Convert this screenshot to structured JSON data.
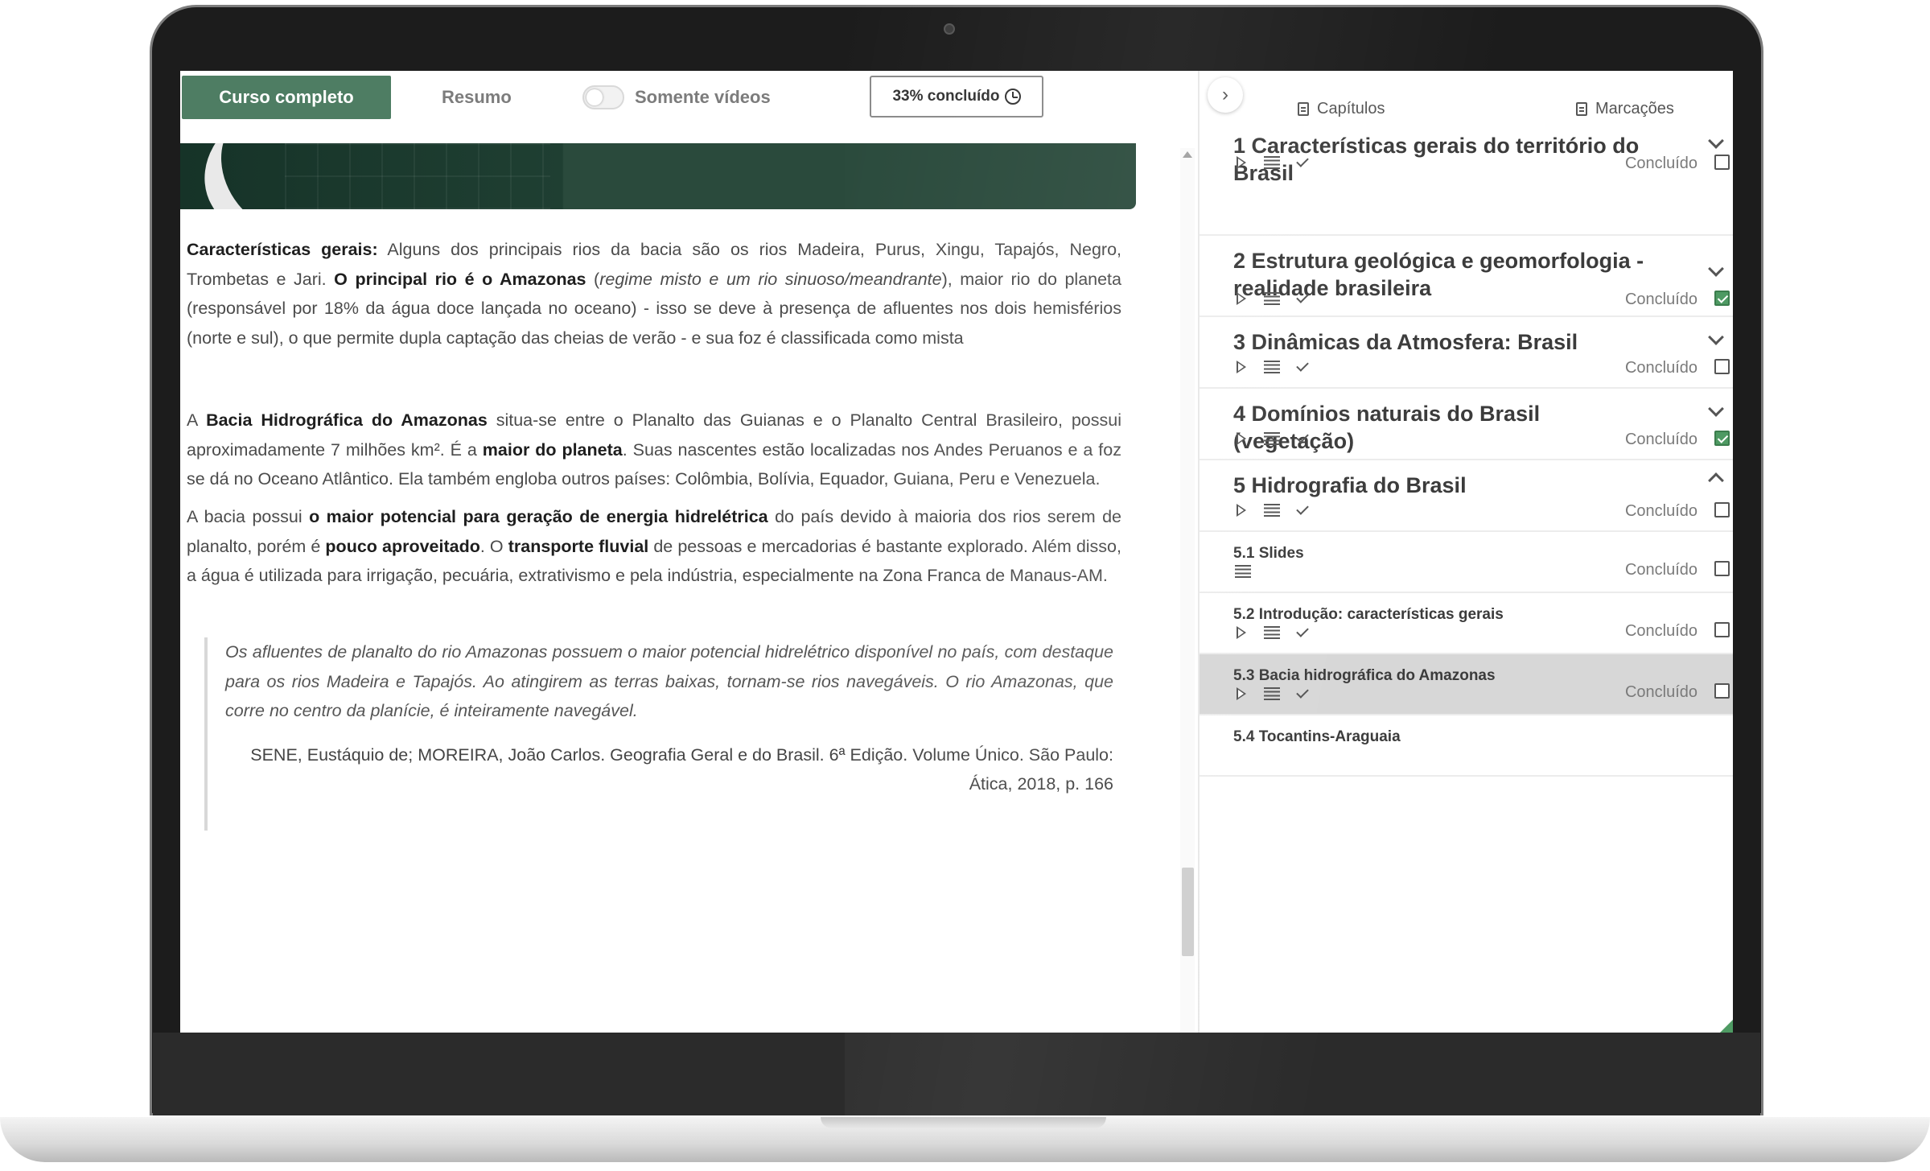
{
  "topbar": {
    "full_course_label": "Curso completo",
    "summary_label": "Resumo",
    "videos_only_label": "Somente vídeos",
    "progress_label": "33% concluído"
  },
  "article": {
    "p1": [
      {
        "t": "Características gerais:",
        "b": true
      },
      {
        "t": " Alguns dos principais rios da bacia são os rios Madeira, Purus, Xingu, Tapajós, Negro, Trombetas e Jari. ",
        "b": false
      },
      {
        "t": "O principal rio é o Amazonas",
        "b": true
      },
      {
        "t": " (",
        "b": false
      },
      {
        "t": "regime misto e um rio sinuoso/meandrante",
        "b": false,
        "i": true
      },
      {
        "t": "), maior rio do planeta (responsável por 18% da água doce lançada no oceano) - isso se deve à presença de afluentes nos dois hemisférios (norte e sul), o que permite dupla captação das cheias de verão -  e sua foz é classificada como mista",
        "b": false
      }
    ],
    "p2": [
      {
        "t": "A ",
        "b": false
      },
      {
        "t": "Bacia Hidrográfica do Amazonas",
        "b": true
      },
      {
        "t": " situa-se entre o Planalto das Guianas e o Planalto Central Brasileiro, possui aproximadamente 7 milhões km². É a ",
        "b": false
      },
      {
        "t": "maior do planeta",
        "b": true
      },
      {
        "t": ". Suas nascentes estão localizadas nos Andes Peruanos e a foz se dá no Oceano Atlântico. Ela também engloba outros países: Colômbia, Bolívia, Equador, Guiana, Peru e Venezuela.",
        "b": false
      }
    ],
    "p3": [
      {
        "t": "A bacia possui ",
        "b": false
      },
      {
        "t": "o maior potencial para geração de energia hidrelétrica",
        "b": true
      },
      {
        "t": " do país devido à maioria dos rios serem de planalto, porém é ",
        "b": false
      },
      {
        "t": "pouco aproveitado",
        "b": true
      },
      {
        "t": ". O ",
        "b": false
      },
      {
        "t": "transporte fluvial",
        "b": true
      },
      {
        "t": " de pessoas e mercadorias é bastante explorado. Além disso, a água é utilizada  para irrigação, pecuária, extrativismo e pela indústria, especialmente na Zona Franca de Manaus-AM.",
        "b": false
      }
    ],
    "quote_text": "Os afluentes de planalto do rio Amazonas possuem o maior potencial hidrelétrico disponível no país, com destaque para os rios Madeira e Tapajós. Ao atingirem as terras baixas, tornam-se rios navegáveis. O rio Amazonas, que corre no centro da planície, é inteiramente navegável.",
    "quote_cite": "SENE, Eustáquio de; MOREIRA, João Carlos. Geografia Geral e do Brasil. 6ª Edição. Volume Único. São Paulo: Ática, 2018, p. 166"
  },
  "sidebar": {
    "tab_chapters": "Capítulos",
    "tab_bookmarks": "Marcações",
    "done_label": "Concluído",
    "chapters": [
      {
        "title": "1 Características gerais do território do Brasil",
        "done": false
      },
      {
        "title": "2 Estrutura geológica e geomorfologia - realidade brasileira",
        "done": true
      },
      {
        "title": "3 Dinâmicas da Atmosfera: Brasil",
        "done": false
      },
      {
        "title": "4 Domínios naturais do Brasil (vegetação)",
        "done": true
      },
      {
        "title": "5 Hidrografia do Brasil",
        "done": false
      }
    ],
    "subsections": [
      {
        "title": "5.1 Slides",
        "done": false
      },
      {
        "title": "5.2 Introdução: características gerais",
        "done": false
      },
      {
        "title": "5.3 Bacia hidrográfica do Amazonas",
        "done": false,
        "active": true
      },
      {
        "title": "5.4 Tocantins-Araguaia"
      }
    ]
  },
  "colors": {
    "accent": "#4e7d63",
    "checked": "#4e9a63"
  }
}
